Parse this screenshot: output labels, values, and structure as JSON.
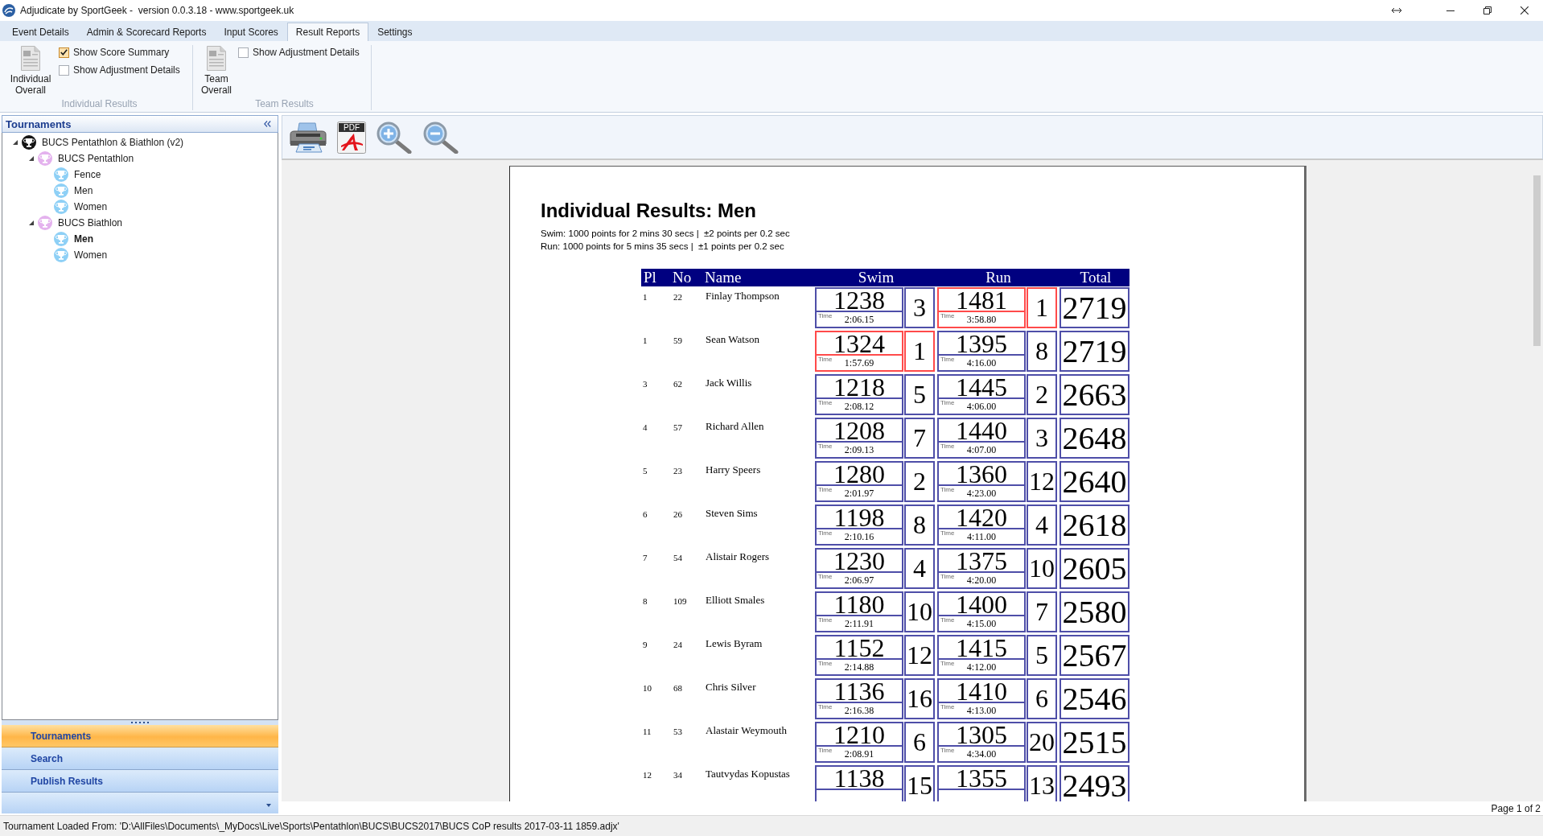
{
  "window": {
    "title": "Adjudicate by SportGeek -  version 0.0.3.18 - www.sportgeek.uk"
  },
  "ribbon": {
    "tabs": [
      {
        "label": "Event Details",
        "selected": false
      },
      {
        "label": "Admin & Scorecard Reports",
        "selected": false
      },
      {
        "label": "Input Scores",
        "selected": false
      },
      {
        "label": "Result Reports",
        "selected": true
      },
      {
        "label": "Settings",
        "selected": false
      }
    ],
    "groups": [
      {
        "title": "Individual Results",
        "button": "Individual Overall",
        "checkboxes": [
          {
            "label": "Show Score Summary",
            "checked": true
          },
          {
            "label": "Show Adjustment Details",
            "checked": false
          }
        ]
      },
      {
        "title": "Team Results",
        "button": "Team Overall",
        "checkboxes": [
          {
            "label": "Show Adjustment Details",
            "checked": false
          }
        ]
      }
    ]
  },
  "sidebar": {
    "title": "Tournaments",
    "tree": [
      {
        "label": "BUCS Pentathlon & Biathlon (v2)",
        "expanded": true,
        "selected": false,
        "children": [
          {
            "label": "BUCS Pentathlon",
            "expanded": true,
            "selected": false,
            "children": [
              {
                "label": "Fence",
                "selected": false
              },
              {
                "label": "Men",
                "selected": false
              },
              {
                "label": "Women",
                "selected": false
              }
            ]
          },
          {
            "label": "BUCS Biathlon",
            "expanded": true,
            "selected": false,
            "children": [
              {
                "label": "Men",
                "selected": true
              },
              {
                "label": "Women",
                "selected": false
              }
            ]
          }
        ]
      }
    ],
    "nav": [
      {
        "label": "Tournaments",
        "selected": true
      },
      {
        "label": "Search",
        "selected": false
      },
      {
        "label": "Publish Results",
        "selected": false
      }
    ]
  },
  "viewer": {
    "toolbar": [
      {
        "kind": "print"
      },
      {
        "kind": "pdf",
        "label": "PDF"
      },
      {
        "kind": "zoom_in"
      },
      {
        "kind": "zoom_out"
      }
    ],
    "page_indicator": "Page 1 of 2"
  },
  "report": {
    "title": "Individual Results: Men",
    "notes": [
      "Swim: 1000 points for 2 mins 30 secs |  ±2 points per 0.2 sec",
      "Run: 1000 points for 5 mins 35 secs |  ±1 points per 0.2 sec"
    ],
    "columns": [
      "Pl",
      "No",
      "Name",
      "Swim",
      "Run",
      "Total"
    ],
    "rows": [
      {
        "place": "1",
        "number": "22",
        "name": "Finlay Thompson",
        "swim": {
          "points": "1238",
          "time_label": "Time",
          "time": "2:06.15",
          "rank": "3",
          "best": false
        },
        "run": {
          "points": "1481",
          "time_label": "Time",
          "time": "3:58.80",
          "rank": "1",
          "best": true
        },
        "total": "2719"
      },
      {
        "place": "1",
        "number": "59",
        "name": "Sean Watson",
        "swim": {
          "points": "1324",
          "time_label": "Time",
          "time": "1:57.69",
          "rank": "1",
          "best": true
        },
        "run": {
          "points": "1395",
          "time_label": "Time",
          "time": "4:16.00",
          "rank": "8",
          "best": false
        },
        "total": "2719"
      },
      {
        "place": "3",
        "number": "62",
        "name": "Jack Willis",
        "swim": {
          "points": "1218",
          "time_label": "Time",
          "time": "2:08.12",
          "rank": "5",
          "best": false
        },
        "run": {
          "points": "1445",
          "time_label": "Time",
          "time": "4:06.00",
          "rank": "2",
          "best": false
        },
        "total": "2663"
      },
      {
        "place": "4",
        "number": "57",
        "name": "Richard Allen",
        "swim": {
          "points": "1208",
          "time_label": "Time",
          "time": "2:09.13",
          "rank": "7",
          "best": false
        },
        "run": {
          "points": "1440",
          "time_label": "Time",
          "time": "4:07.00",
          "rank": "3",
          "best": false
        },
        "total": "2648"
      },
      {
        "place": "5",
        "number": "23",
        "name": "Harry Speers",
        "swim": {
          "points": "1280",
          "time_label": "Time",
          "time": "2:01.97",
          "rank": "2",
          "best": false
        },
        "run": {
          "points": "1360",
          "time_label": "Time",
          "time": "4:23.00",
          "rank": "12",
          "best": false
        },
        "total": "2640"
      },
      {
        "place": "6",
        "number": "26",
        "name": "Steven Sims",
        "swim": {
          "points": "1198",
          "time_label": "Time",
          "time": "2:10.16",
          "rank": "8",
          "best": false
        },
        "run": {
          "points": "1420",
          "time_label": "Time",
          "time": "4:11.00",
          "rank": "4",
          "best": false
        },
        "total": "2618"
      },
      {
        "place": "7",
        "number": "54",
        "name": "Alistair Rogers",
        "swim": {
          "points": "1230",
          "time_label": "Time",
          "time": "2:06.97",
          "rank": "4",
          "best": false
        },
        "run": {
          "points": "1375",
          "time_label": "Time",
          "time": "4:20.00",
          "rank": "10",
          "best": false
        },
        "total": "2605"
      },
      {
        "place": "8",
        "number": "109",
        "name": "Elliott Smales",
        "swim": {
          "points": "1180",
          "time_label": "Time",
          "time": "2:11.91",
          "rank": "10",
          "best": false
        },
        "run": {
          "points": "1400",
          "time_label": "Time",
          "time": "4:15.00",
          "rank": "7",
          "best": false
        },
        "total": "2580"
      },
      {
        "place": "9",
        "number": "24",
        "name": "Lewis Byram",
        "swim": {
          "points": "1152",
          "time_label": "Time",
          "time": "2:14.88",
          "rank": "12",
          "best": false
        },
        "run": {
          "points": "1415",
          "time_label": "Time",
          "time": "4:12.00",
          "rank": "5",
          "best": false
        },
        "total": "2567"
      },
      {
        "place": "10",
        "number": "68",
        "name": "Chris Silver",
        "swim": {
          "points": "1136",
          "time_label": "Time",
          "time": "2:16.38",
          "rank": "16",
          "best": false
        },
        "run": {
          "points": "1410",
          "time_label": "Time",
          "time": "4:13.00",
          "rank": "6",
          "best": false
        },
        "total": "2546"
      },
      {
        "place": "11",
        "number": "53",
        "name": "Alastair Weymouth",
        "swim": {
          "points": "1210",
          "time_label": "Time",
          "time": "2:08.91",
          "rank": "6",
          "best": false
        },
        "run": {
          "points": "1305",
          "time_label": "Time",
          "time": "4:34.00",
          "rank": "20",
          "best": false
        },
        "total": "2515"
      },
      {
        "place": "12",
        "number": "34",
        "name": "Tautvydas Kopustas",
        "swim": {
          "points": "1138",
          "rank": "15",
          "best": false
        },
        "run": {
          "points": "1355",
          "rank": "13",
          "best": false
        },
        "total": "2493"
      }
    ]
  },
  "status_bar": "Tournament Loaded From: 'D:\\AllFiles\\Documents\\_MyDocs\\Live\\Sports\\Pentathlon\\BUCS\\BUCS2017\\BUCS CoP results 2017-03-11 1859.adjx'"
}
